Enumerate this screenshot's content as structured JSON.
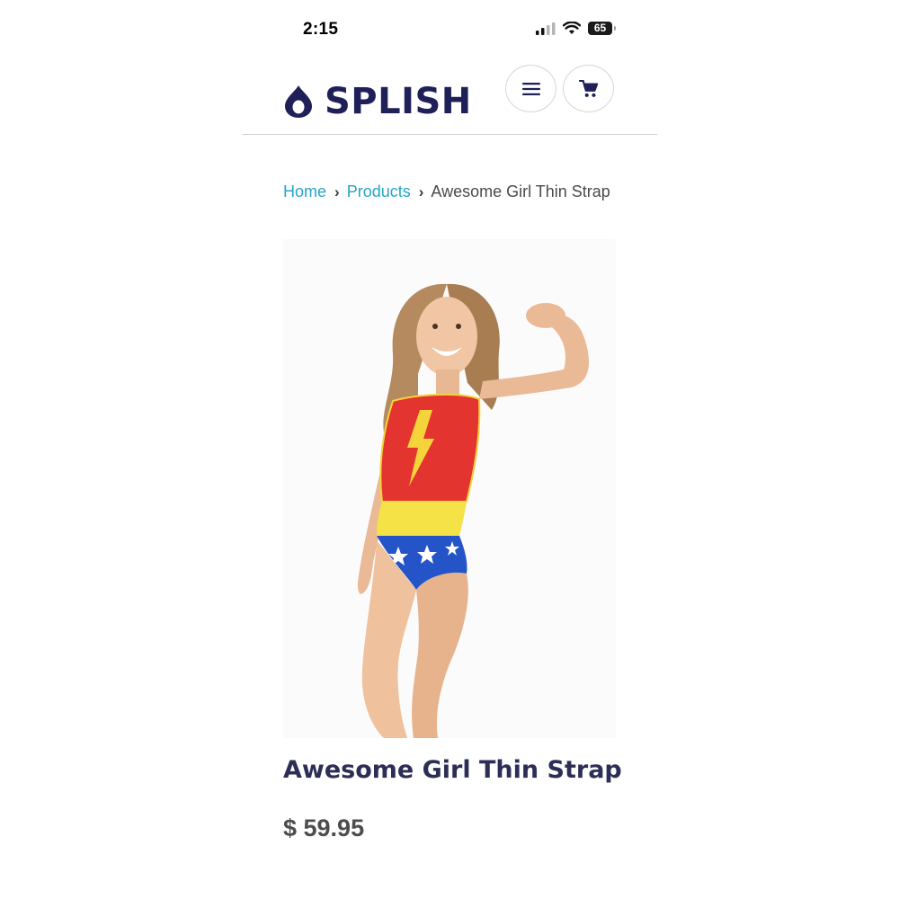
{
  "status_bar": {
    "time": "2:15",
    "battery": "65",
    "signal_icon": "cellular-signal-icon",
    "wifi_icon": "wifi-icon"
  },
  "header": {
    "logo_text": "SPLISH",
    "logo_icon": "water-drop-icon",
    "menu_icon": "hamburger-menu-icon",
    "cart_icon": "shopping-cart-icon",
    "brand_color": "#1f2058"
  },
  "breadcrumb": {
    "items": [
      "Home",
      "Products",
      "Awesome Girl Thin Strap"
    ],
    "link_color": "#24a6c6"
  },
  "product": {
    "title": "Awesome Girl Thin Strap",
    "price": "$ 59.95"
  }
}
